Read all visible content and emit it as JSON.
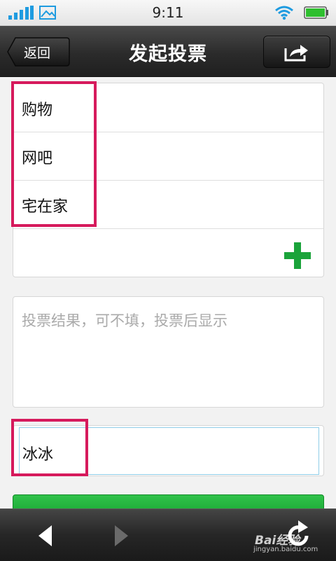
{
  "status_bar": {
    "time": "9:11"
  },
  "header": {
    "back_label": "返回",
    "title": "发起投票"
  },
  "options": {
    "items": [
      "购物",
      "网吧",
      "宅在家"
    ]
  },
  "result_field": {
    "placeholder": "投票结果，可不填，投票后显示"
  },
  "name_field": {
    "value": "冰冰"
  },
  "watermark": {
    "brand": "Bai经验",
    "url": "jingyan.baidu.com"
  },
  "colors": {
    "highlight": "#d61a5c",
    "add_icon": "#1aa33a",
    "submit": "#22b53e"
  }
}
